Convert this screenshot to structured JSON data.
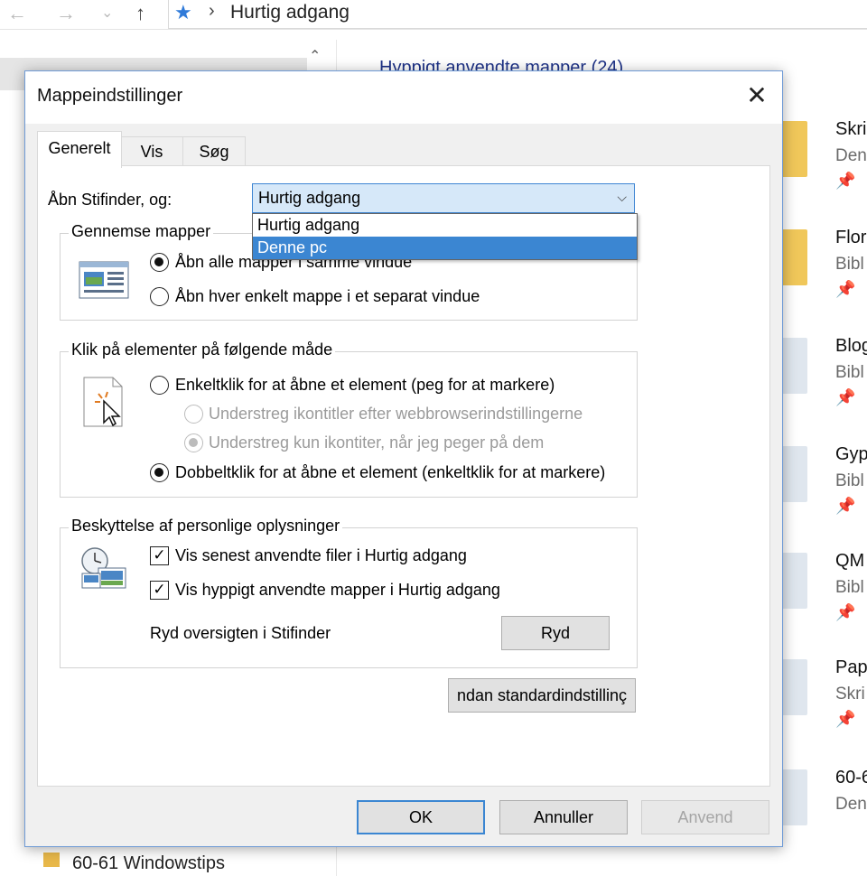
{
  "explorer": {
    "nav": {
      "back": "←",
      "forward": "→",
      "recent": "⌄",
      "up": "↑"
    },
    "address": {
      "star": "★",
      "separator": "›",
      "path": "Hurtig adgang"
    },
    "navpane": {
      "scroll_up": "⌃",
      "folder_label": "60-61 Windowstips"
    },
    "group_header": "Hyppigt anvendte mapper (24)",
    "items": [
      {
        "title": "Skri",
        "sub": "Den"
      },
      {
        "title": "Flor",
        "sub": "Bibl"
      },
      {
        "title": "Blog",
        "sub": "Bibl"
      },
      {
        "title": "Gyp",
        "sub": "Bibl"
      },
      {
        "title": "QM",
        "sub": "Bibl"
      },
      {
        "title": "Pap",
        "sub": "Skri"
      },
      {
        "title": "60-6",
        "sub": "Den"
      }
    ],
    "pin_glyph": "📌"
  },
  "dialog": {
    "title": "Mappeindstillinger",
    "close_glyph": "✕",
    "tabs": [
      {
        "label": "Generelt"
      },
      {
        "label": "Vis"
      },
      {
        "label": "Søg"
      }
    ],
    "open_explorer_label": "Åbn Stifinder, og:",
    "open_explorer_value": "Hurtig adgang",
    "dropdown_arrow": "⌵",
    "dropdown_options": [
      "Hurtig adgang",
      "Denne pc"
    ],
    "browse": {
      "title": "Gennemse mapper",
      "opt_same": "Åbn alle mapper i samme vindue",
      "opt_separate": "Åbn hver enkelt mappe i et separat vindue"
    },
    "click": {
      "title": "Klik på elementer på følgende måde",
      "opt_single": "Enkeltklik for at åbne et element (peg for at markere)",
      "sub_browser": "Understreg ikontitler efter webbrowserindstillingerne",
      "sub_hover": "Understreg kun ikontiter, når jeg peger på dem",
      "opt_double": "Dobbeltklik for at åbne et element (enkeltklik for at markere)"
    },
    "privacy": {
      "title": "Beskyttelse af personlige oplysninger",
      "check_recent": "Vis senest anvendte filer i Hurtig adgang",
      "check_frequent": "Vis hyppigt anvendte mapper i Hurtig adgang",
      "clear_label": "Ryd oversigten i Stifinder",
      "clear_button": "Ryd"
    },
    "check_glyph": "✓",
    "restore_defaults": "ndan standardindstillinç",
    "ok": "OK",
    "cancel": "Annuller",
    "apply": "Anvend"
  }
}
